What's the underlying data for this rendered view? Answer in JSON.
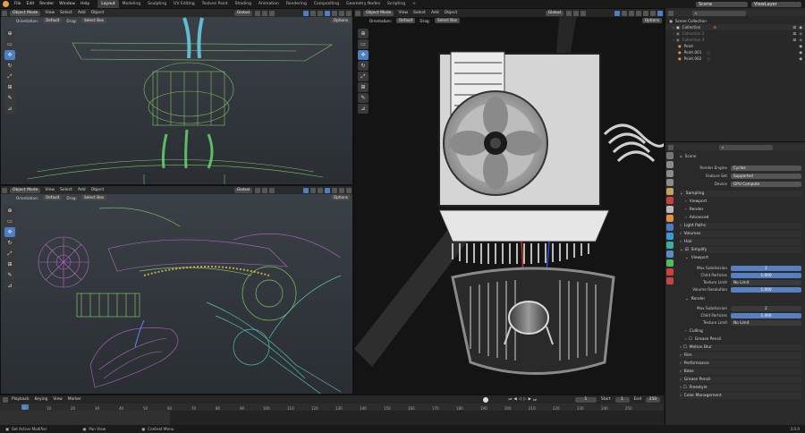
{
  "topbar": {
    "menus": [
      "File",
      "Edit",
      "Render",
      "Window",
      "Help"
    ],
    "workspaces": [
      "Layout",
      "Modeling",
      "Sculpting",
      "UV Editing",
      "Texture Paint",
      "Shading",
      "Animation",
      "Rendering",
      "Compositing",
      "Geometry Nodes",
      "Scripting"
    ],
    "active_workspace": "Layout",
    "add_tab": "+",
    "scene_label": "Scene",
    "viewlayer_label": "ViewLayer"
  },
  "viewport_header": {
    "mode": "Object Mode",
    "menus": [
      "View",
      "Select",
      "Add",
      "Object"
    ],
    "transform": "Global",
    "options": "Options"
  },
  "viewport_sub": {
    "orientation_label": "Orientation:",
    "orientation_value": "Default",
    "drag_label": "Drag:",
    "drag_value": "Select Box"
  },
  "toolbar_icons": [
    "cursor-icon",
    "select-box-icon",
    "move-icon",
    "rotate-icon",
    "scale-icon",
    "transform-icon",
    "annotate-icon",
    "measure-icon",
    "add-cube-icon"
  ],
  "outliner": {
    "title": "Scene Collection",
    "items": [
      {
        "label": "Collection",
        "indent": 1,
        "color": "#d0d0d0"
      },
      {
        "label": "Collection 2",
        "indent": 1,
        "color": "#7a7a7a"
      },
      {
        "label": "Collection 3",
        "indent": 1,
        "color": "#7a7a7a"
      },
      {
        "label": "Point",
        "indent": 1,
        "color": "#d0d0d0"
      },
      {
        "label": "Point.001",
        "indent": 1,
        "color": "#d0d0d0"
      },
      {
        "label": "Point.002",
        "indent": 1,
        "color": "#d0d0d0"
      }
    ]
  },
  "properties": {
    "breadcrumb": "Scene",
    "render_engine_label": "Render Engine",
    "render_engine_value": "Cycles",
    "feature_set_label": "Feature Set",
    "feature_set_value": "Supported",
    "device_label": "Device",
    "device_value": "GPU Compute",
    "panels": {
      "sampling": "Sampling",
      "viewport": "Viewport",
      "render": "Render",
      "advanced": "Advanced",
      "light_paths": "Light Paths",
      "volumes": "Volumes",
      "hair": "Hair",
      "simplify": "Simplify",
      "simplify_viewport": "Viewport",
      "simplify_render": "Render",
      "culling": "Culling",
      "grease_pencil_sub": "Grease Pencil",
      "motion_blur": "Motion Blur",
      "film": "Film",
      "performance": "Performance",
      "bake": "Bake",
      "grease_pencil": "Grease Pencil",
      "freestyle": "Freestyle",
      "color_management": "Color Management"
    },
    "viewport_fields": [
      {
        "label": "Max Subdivision",
        "value": "2",
        "kind": "num"
      },
      {
        "label": "Child Particles",
        "value": "1.000",
        "kind": "num"
      },
      {
        "label": "Texture Limit",
        "value": "No Limit",
        "kind": "dd"
      },
      {
        "label": "Volume Resolution",
        "value": "1.000",
        "kind": "num"
      }
    ],
    "render_fields": [
      {
        "label": "Max Subdivision",
        "value": "2",
        "kind": "num"
      },
      {
        "label": "Child Particles",
        "value": "1.000",
        "kind": "num"
      },
      {
        "label": "Texture Limit",
        "value": "No Limit",
        "kind": "dd"
      }
    ]
  },
  "timeline": {
    "menus": [
      "Playback",
      "Keying",
      "View",
      "Marker"
    ],
    "current_frame": "1",
    "start_label": "Start",
    "start_value": "1",
    "end_label": "End",
    "end_value": "250",
    "ruler": [
      "0",
      "10",
      "20",
      "30",
      "40",
      "50",
      "60",
      "70",
      "80",
      "90",
      "100",
      "110",
      "120",
      "130",
      "140",
      "150",
      "160",
      "170",
      "180",
      "190",
      "200",
      "210",
      "220",
      "230",
      "240",
      "250"
    ]
  },
  "statusbar": {
    "left": "Set Active Modifier",
    "middle": "Pan View",
    "right": "Context Menu",
    "version": "3.0.0"
  },
  "colors": {
    "accent": "#4d7fc4",
    "panel": "#2a2a2a",
    "header": "#282828",
    "wire_green": "#8fd86a",
    "wire_magenta": "#d070e0",
    "wire_cyan": "#5ad6c8"
  }
}
